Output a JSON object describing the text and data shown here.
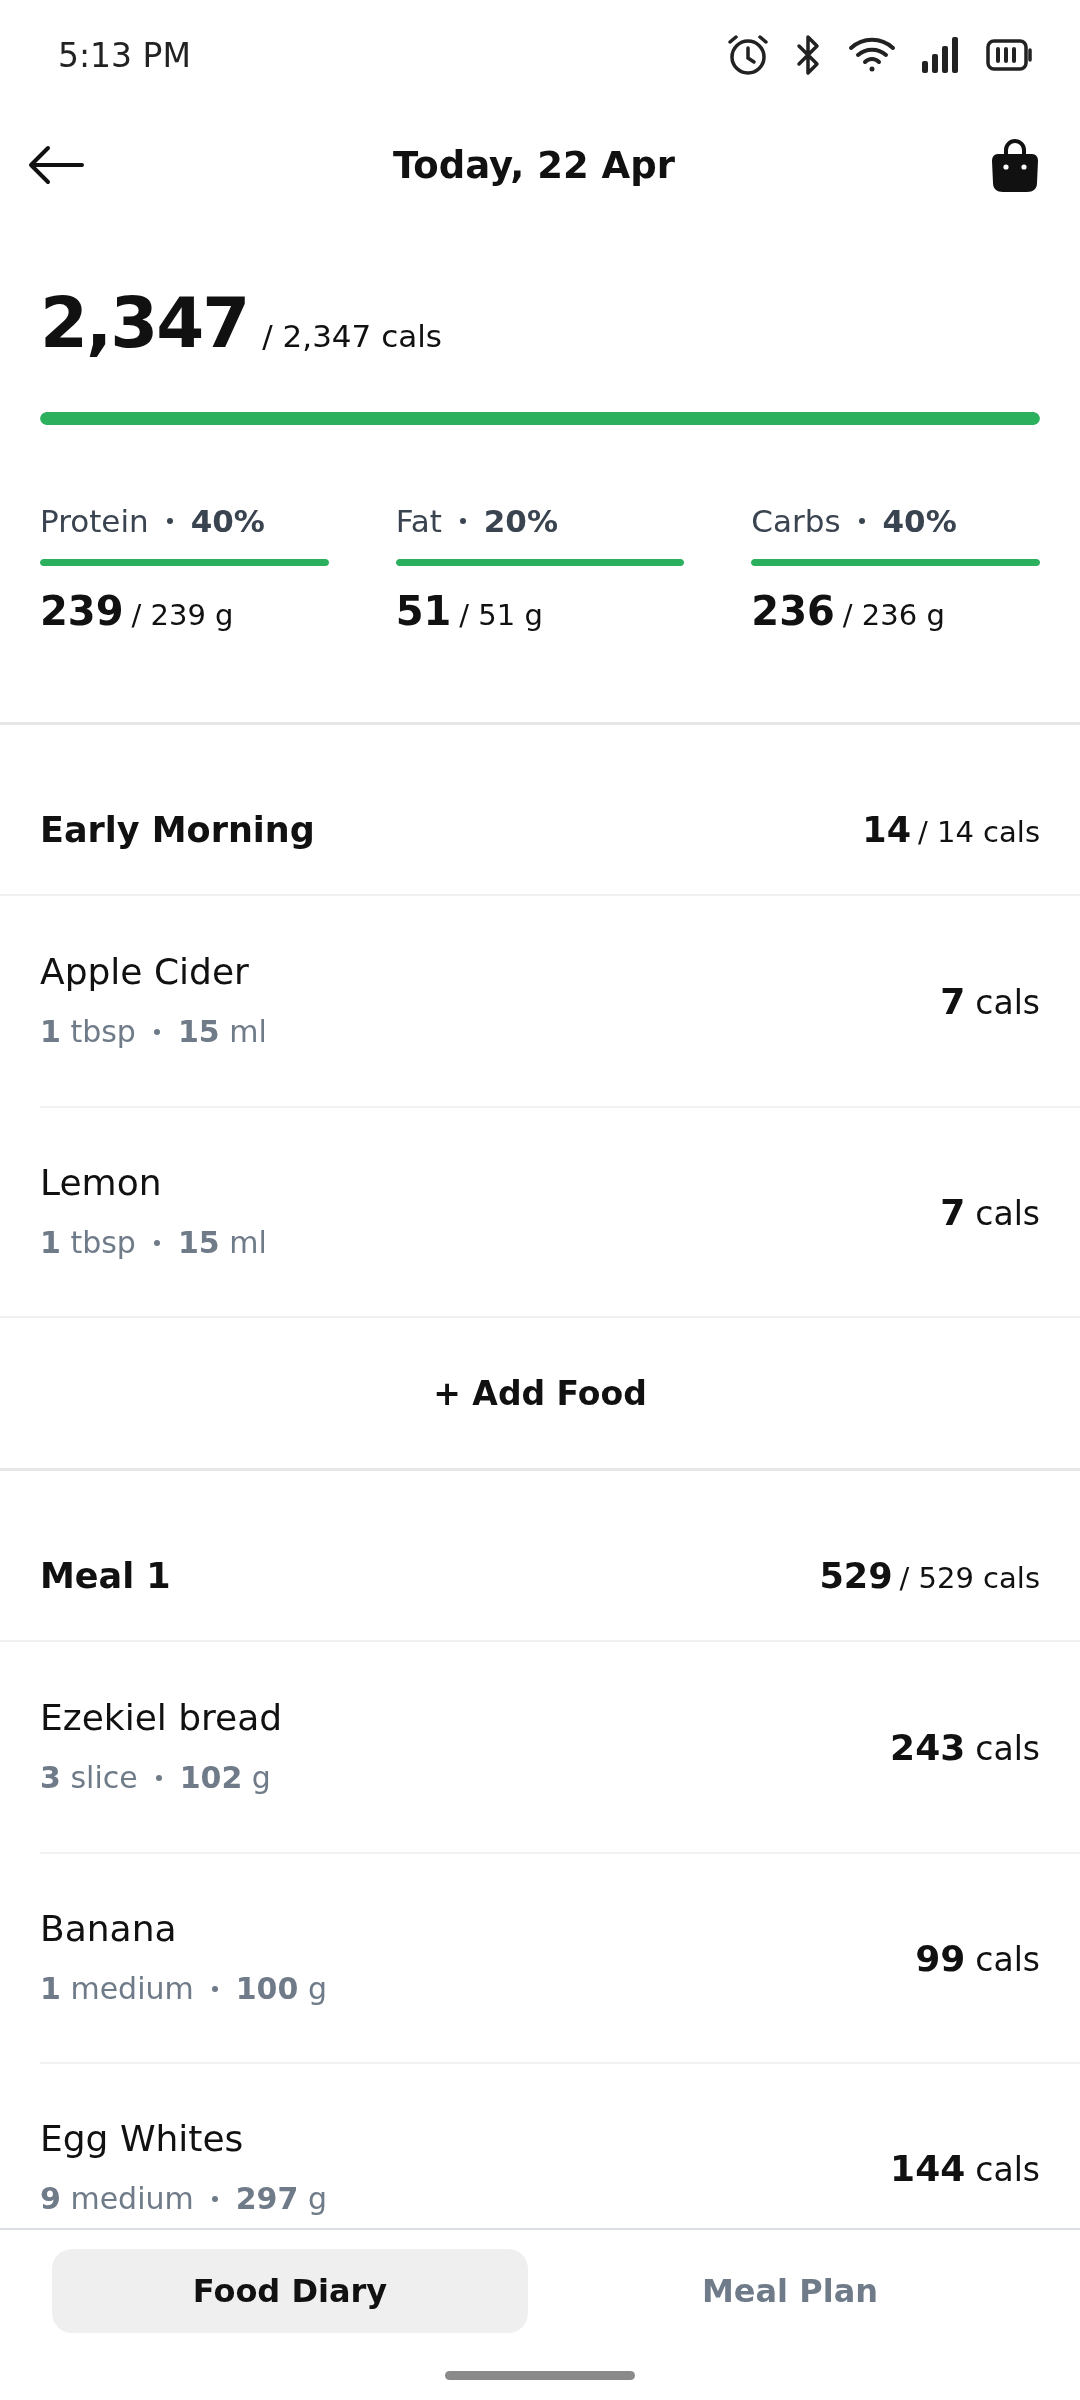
{
  "status_bar": {
    "time": "5:13 PM"
  },
  "header": {
    "title": "Today, 22 Apr"
  },
  "summary": {
    "consumed": "2,347",
    "target": "/ 2,347 cals",
    "level": 1.0,
    "macros": [
      {
        "name": "Protein",
        "percent": "40%",
        "consumed": "239",
        "target": "/ 239 g",
        "level": 1.0
      },
      {
        "name": "Fat",
        "percent": "20%",
        "consumed": "51",
        "target": "/ 51 g",
        "level": 1.0
      },
      {
        "name": "Carbs",
        "percent": "40%",
        "consumed": "236",
        "target": "/ 236 g",
        "level": 1.0
      }
    ]
  },
  "meals": [
    {
      "name": "Early Morning",
      "consumed": "14",
      "target": "/ 14 cals",
      "foods": [
        {
          "name": "Apple Cider",
          "portion": "**1** tbsp",
          "weight": "**15** ml",
          "calories": "7",
          "unit": "cals"
        },
        {
          "name": "Lemon",
          "portion": "**1** tbsp",
          "weight": "**15** ml",
          "calories": "7",
          "unit": "cals"
        }
      ],
      "add_button": "+ Add Food"
    },
    {
      "name": "Meal 1",
      "consumed": "529",
      "target": "/ 529 cals",
      "foods": [
        {
          "name": "Ezekiel bread",
          "portion": "**3** slice",
          "weight": "**102** g",
          "calories": "243",
          "unit": "cals"
        },
        {
          "name": "Banana",
          "portion": "**1** medium",
          "weight": "**100** g",
          "calories": "99",
          "unit": "cals"
        },
        {
          "name": "Egg Whites",
          "portion": "**9** medium",
          "weight": "**297** g",
          "calories": "144",
          "unit": "cals"
        }
      ]
    }
  ],
  "tabs": [
    {
      "label": "Food Diary",
      "selected": true
    },
    {
      "label": "Meal Plan",
      "selected": false
    }
  ]
}
